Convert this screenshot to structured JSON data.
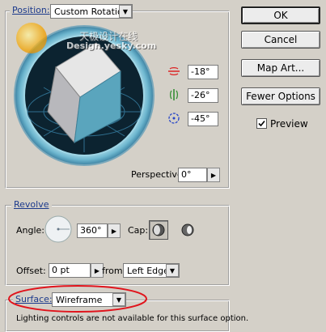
{
  "position": {
    "legend": "Position:",
    "preset": "Custom Rotation",
    "rot_x": "-18°",
    "rot_y": "-26°",
    "rot_z": "-45°",
    "perspective_label": "Perspective:",
    "perspective_value": "0°"
  },
  "revolve": {
    "legend": "Revolve",
    "angle_label": "Angle:",
    "angle_value": "360°",
    "cap_label": "Cap:",
    "offset_label": "Offset:",
    "offset_value": "0 pt",
    "from_label": "from",
    "from_value": "Left Edge"
  },
  "surface": {
    "label": "Surface:",
    "value": "Wireframe",
    "note": "Lighting controls are not available for this surface option."
  },
  "buttons": {
    "ok": "OK",
    "cancel": "Cancel",
    "map_art": "Map Art...",
    "fewer_options": "Fewer Options",
    "preview": "Preview"
  },
  "watermark": {
    "line1": "天极设计在线",
    "line2": "Design.yesky.com"
  },
  "colors": {
    "legend": "#1c3a8c",
    "highlight_ellipse": "#e0141c",
    "cube_front": "#5aa5bd",
    "cube_top": "#e6e6e6",
    "cube_side": "#b8b8bc"
  }
}
